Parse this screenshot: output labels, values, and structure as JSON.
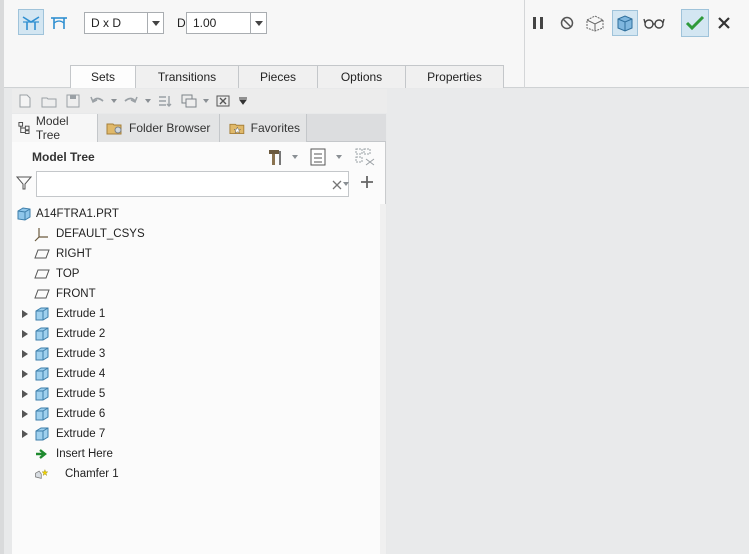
{
  "dashboard": {
    "type_select": {
      "value": "D x D"
    },
    "d_label": "D",
    "d_select": {
      "value": "1.00"
    },
    "tabs": [
      {
        "label": "Sets",
        "active": true
      },
      {
        "label": "Transitions",
        "active": false
      },
      {
        "label": "Pieces",
        "active": false
      },
      {
        "label": "Options",
        "active": false
      },
      {
        "label": "Properties",
        "active": false
      }
    ]
  },
  "nav": {
    "tabs": [
      {
        "label": "Model Tree",
        "active": true
      },
      {
        "label": "Folder Browser",
        "active": false
      },
      {
        "label": "Favorites",
        "active": false
      }
    ]
  },
  "model_tree": {
    "title": "Model Tree",
    "search": {
      "value": "",
      "placeholder": ""
    },
    "items": [
      {
        "label": "A14FTRA1.PRT",
        "icon": "part-icon",
        "expandable": false
      },
      {
        "label": "DEFAULT_CSYS",
        "icon": "csys-icon",
        "expandable": false
      },
      {
        "label": "RIGHT",
        "icon": "datum-plane-icon",
        "expandable": false
      },
      {
        "label": "TOP",
        "icon": "datum-plane-icon",
        "expandable": false
      },
      {
        "label": "FRONT",
        "icon": "datum-plane-icon",
        "expandable": false
      },
      {
        "label": "Extrude 1",
        "icon": "extrude-icon",
        "expandable": true
      },
      {
        "label": "Extrude 2",
        "icon": "extrude-icon",
        "expandable": true
      },
      {
        "label": "Extrude 3",
        "icon": "extrude-icon",
        "expandable": true
      },
      {
        "label": "Extrude 4",
        "icon": "extrude-icon",
        "expandable": true
      },
      {
        "label": "Extrude 5",
        "icon": "extrude-icon",
        "expandable": true
      },
      {
        "label": "Extrude 6",
        "icon": "extrude-icon",
        "expandable": true
      },
      {
        "label": "Extrude 7",
        "icon": "extrude-icon",
        "expandable": true
      },
      {
        "label": "Insert Here",
        "icon": "insert-here-icon",
        "expandable": false
      },
      {
        "label": "Chamfer 1",
        "icon": "chamfer-icon",
        "expandable": false
      }
    ]
  },
  "colors": {
    "accent_blue": "#2f8fd1",
    "ok_green": "#2e9a3a",
    "active_bg": "#d3e6f2"
  }
}
